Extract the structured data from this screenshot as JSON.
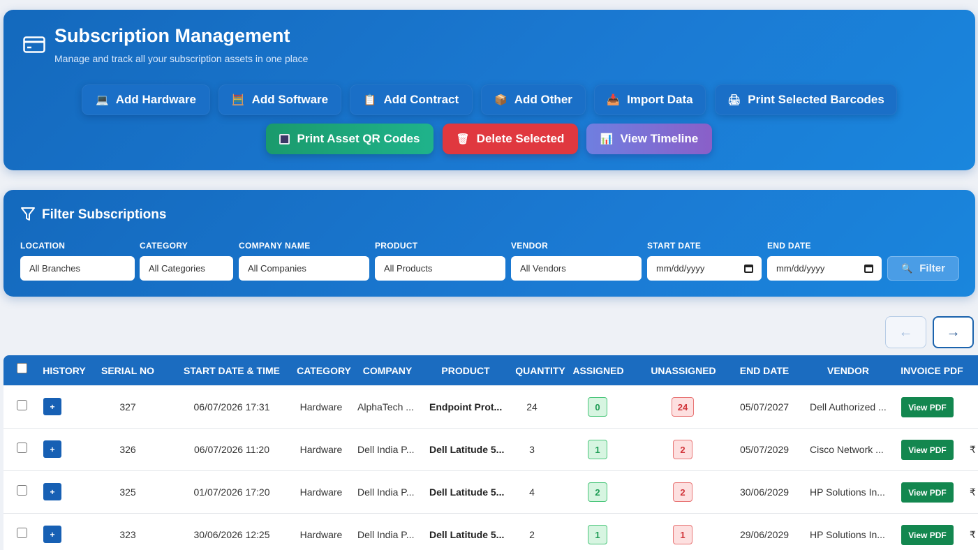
{
  "header": {
    "title": "Subscription Management",
    "subtitle": "Manage and track all your subscription assets in one place",
    "buttons_row1": [
      {
        "label": "Add Hardware",
        "icon": "💻"
      },
      {
        "label": "Add Software",
        "icon": "🧮"
      },
      {
        "label": "Add Contract",
        "icon": "📋"
      },
      {
        "label": "Add Other",
        "icon": "📦"
      },
      {
        "label": "Import Data",
        "icon": "📥"
      },
      {
        "label": "Print Selected Barcodes",
        "icon": "🖨"
      }
    ],
    "buttons_row2": [
      {
        "label": "Print Asset QR Codes",
        "icon": "qr-square-icon"
      },
      {
        "label": "Delete Selected",
        "icon": "🗑"
      },
      {
        "label": "View Timeline",
        "icon": "📊"
      }
    ]
  },
  "filter": {
    "title": "Filter Subscriptions",
    "fields": [
      {
        "label": "LOCATION",
        "value": "All Branches"
      },
      {
        "label": "CATEGORY",
        "value": "All Categories"
      },
      {
        "label": "COMPANY NAME",
        "value": "All Companies"
      },
      {
        "label": "PRODUCT",
        "value": "All Products"
      },
      {
        "label": "VENDOR",
        "value": "All Vendors"
      },
      {
        "label": "START DATE",
        "value": "mm/dd/yyyy"
      },
      {
        "label": "END DATE",
        "value": "mm/dd/yyyy"
      }
    ],
    "button_label": "Filter",
    "button_icon": "🔍"
  },
  "pager": {
    "prev": "←",
    "next": "→"
  },
  "table": {
    "columns": [
      "HISTORY",
      "SERIAL NO",
      "START DATE & TIME",
      "CATEGORY",
      "COMPANY",
      "PRODUCT",
      "QUANTITY",
      "ASSIGNED",
      "UNASSIGNED",
      "END DATE",
      "VENDOR",
      "INVOICE PDF"
    ],
    "rows": [
      {
        "history": "+",
        "serial": "327",
        "start": "06/07/2026 17:31",
        "category": "Hardware",
        "company": "AlphaTech ...",
        "product": "Endpoint Prot...",
        "quantity": "24",
        "assigned": "0",
        "unassigned": "24",
        "end": "05/07/2027",
        "vendor": "Dell Authorized ...",
        "pdf": "View PDF",
        "extra": ""
      },
      {
        "history": "+",
        "serial": "326",
        "start": "06/07/2026 11:20",
        "category": "Hardware",
        "company": "Dell India P...",
        "product": "Dell Latitude 5...",
        "quantity": "3",
        "assigned": "1",
        "unassigned": "2",
        "end": "05/07/2029",
        "vendor": "Cisco Network ...",
        "pdf": "View PDF",
        "extra": "₹"
      },
      {
        "history": "+",
        "serial": "325",
        "start": "01/07/2026 17:20",
        "category": "Hardware",
        "company": "Dell India P...",
        "product": "Dell Latitude 5...",
        "quantity": "4",
        "assigned": "2",
        "unassigned": "2",
        "end": "30/06/2029",
        "vendor": "HP Solutions In...",
        "pdf": "View PDF",
        "extra": "₹"
      },
      {
        "history": "+",
        "serial": "323",
        "start": "30/06/2026 12:25",
        "category": "Hardware",
        "company": "Dell India P...",
        "product": "Dell Latitude 5...",
        "quantity": "2",
        "assigned": "1",
        "unassigned": "1",
        "end": "29/06/2029",
        "vendor": "HP Solutions In...",
        "pdf": "View PDF",
        "extra": "₹"
      }
    ]
  }
}
